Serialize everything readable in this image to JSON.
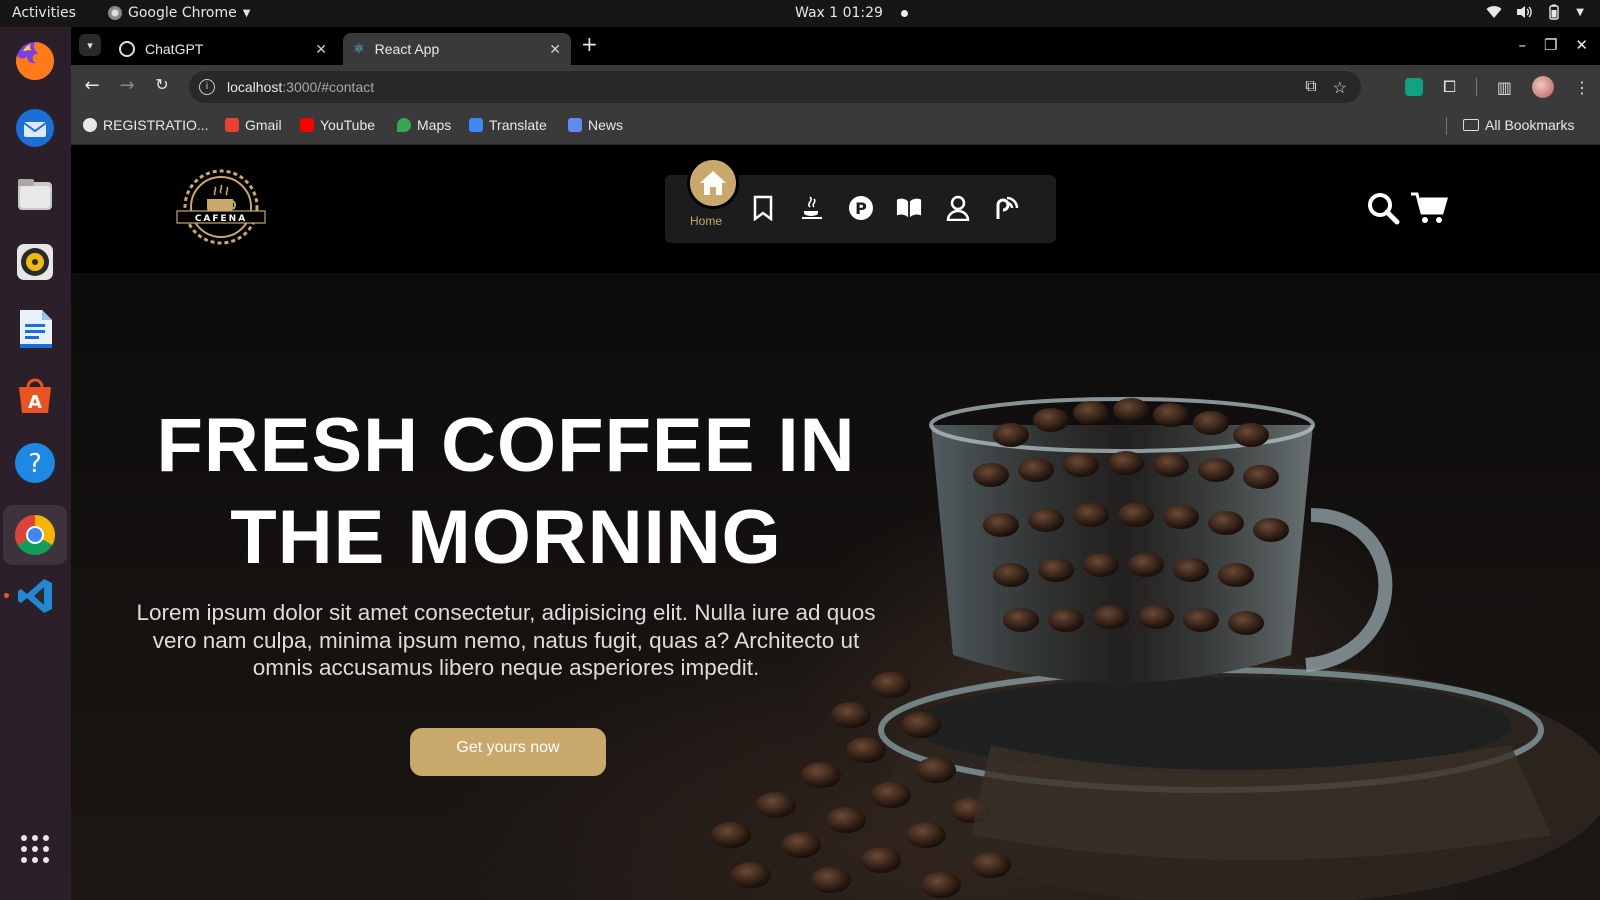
{
  "system_bar": {
    "activities": "Activities",
    "app_menu": "Google Chrome",
    "clock": "Wax 1  01:29"
  },
  "dock": {
    "apps": [
      "firefox-icon",
      "thunderbird-icon",
      "files-icon",
      "rhythmbox-icon",
      "writer-icon",
      "app-center-icon",
      "help-icon",
      "chrome-icon",
      "vscode-icon",
      "show-apps-icon"
    ]
  },
  "browser": {
    "tabs": [
      {
        "label": "ChatGPT",
        "active": false
      },
      {
        "label": "React App",
        "active": true
      }
    ],
    "url_host": "localhost",
    "url_path": ":3000/#contact",
    "bookmarks": [
      {
        "label": "REGISTRATIO...",
        "color": "#e8e8e8"
      },
      {
        "label": "Gmail",
        "color": "#ea4335"
      },
      {
        "label": "YouTube",
        "color": "#ff0000"
      },
      {
        "label": "Maps",
        "color": "#34a853"
      },
      {
        "label": "Translate",
        "color": "#4285f4"
      },
      {
        "label": "News",
        "color": "#5f8bf0"
      }
    ],
    "all_bookmarks": "All Bookmarks"
  },
  "site": {
    "logo_text": "CAFENA",
    "nav": {
      "home_label": "Home",
      "items": [
        "bookmark-icon",
        "java-cup-icon",
        "parking-icon",
        "book-icon",
        "user-icon",
        "blog-icon"
      ]
    },
    "accent": "#c9a86b",
    "hero": {
      "headline_line1": "FRESH COFFEE IN",
      "headline_line2": "THE MORNING",
      "body": "Lorem ipsum dolor sit amet consectetur, adipisicing elit. Nulla iure ad quos vero nam culpa, minima ipsum nemo, natus fugit, quas a? Architecto ut omnis accusamus libero neque asperiores impedit.",
      "cta": "Get yours now"
    }
  }
}
